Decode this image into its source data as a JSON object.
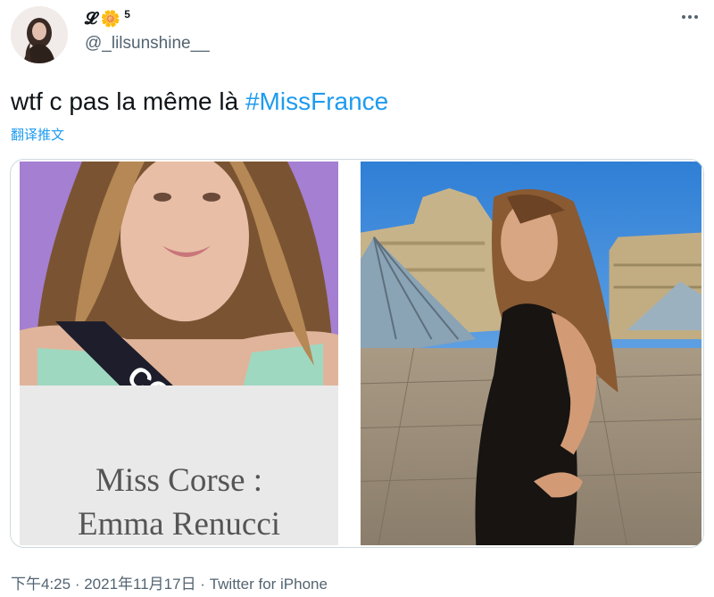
{
  "author": {
    "display_name": "𝓛",
    "name_emoji": "🌼",
    "name_suffix": "5",
    "handle": "@_lilsunshine__"
  },
  "tweet": {
    "text_prefix": "wtf c pas la même là ",
    "hashtag": "#MissFrance",
    "translate_label": "翻译推文"
  },
  "media": {
    "left_photo": {
      "caption_line1": "Miss Corse :",
      "caption_line2": "Emma Renucci",
      "sash_text": "CO"
    }
  },
  "meta": {
    "time": "下午4:25",
    "separator1": " · ",
    "date": "2021年11月17日",
    "separator2": " · ",
    "source": "Twitter for iPhone"
  },
  "colors": {
    "accent": "#1d9bf0",
    "secondary_text": "#536471",
    "border": "#cfd9de"
  }
}
